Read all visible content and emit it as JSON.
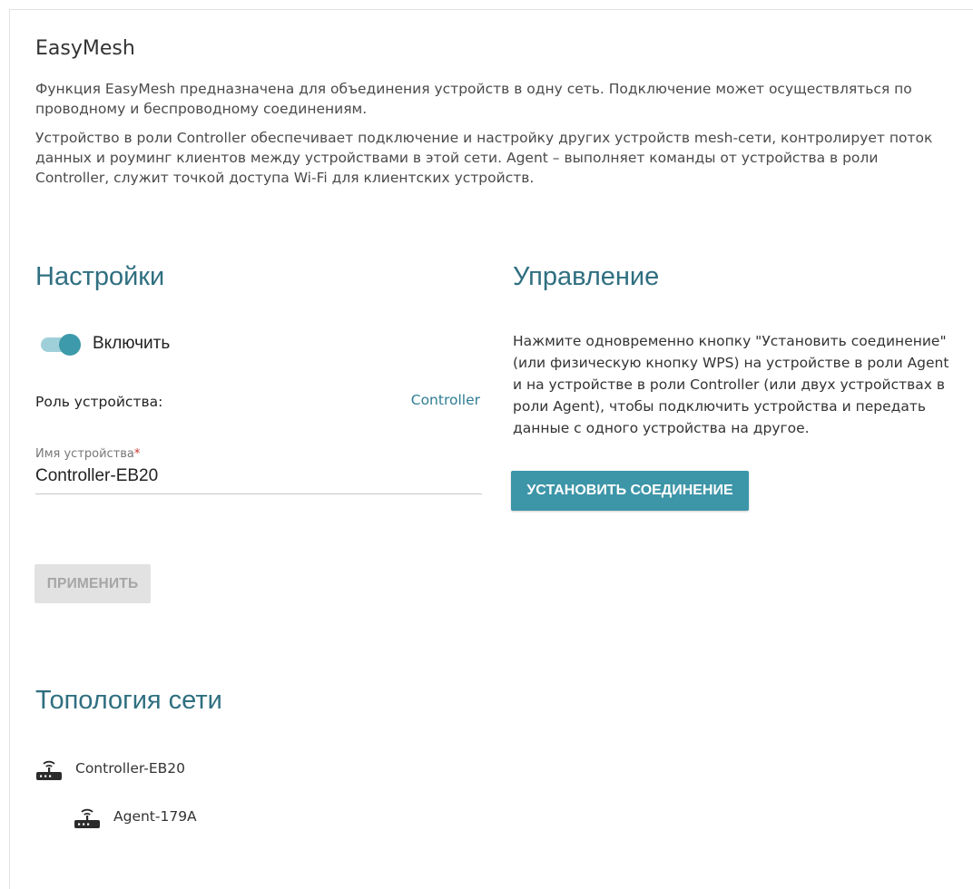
{
  "page": {
    "title": "EasyMesh",
    "description_1": "Функция EasyMesh предназначена для объединения устройств в одну сеть. Подключение может осуществляться по проводному и беспроводному соединениям.",
    "description_2": "Устройство в роли Controller обеспечивает подключение и настройку других устройств mesh-сети, контролирует поток данных и роуминг клиентов между устройствами в этой сети. Agent – выполняет команды от устройства в роли Controller, служит точкой доступа Wi-Fi для клиентских устройств."
  },
  "settings": {
    "title": "Настройки",
    "enable_toggle": {
      "label": "Включить",
      "state": "on"
    },
    "role_label": "Роль устройства:",
    "role_value": "Controller",
    "device_name_label": "Имя устройства",
    "required_mark": "*",
    "device_name_value": "Controller-EB20",
    "apply_label": "ПРИМЕНИТЬ"
  },
  "control": {
    "title": "Управление",
    "text": "Нажмите одновременно кнопку \"Установить соединение\" (или физическую кнопку WPS) на устройстве в роли Agent и на устройстве в роли Controller (или двух устройствах в роли Agent), чтобы подключить устройства и передать данные с одного устройства на другое.",
    "connect_label": "УСТАНОВИТЬ СОЕДИНЕНИЕ"
  },
  "topology": {
    "title": "Топология сети",
    "nodes": [
      {
        "name": "Controller-EB20",
        "icon": "router-icon"
      },
      {
        "name": "Agent-179A",
        "icon": "router-icon"
      }
    ]
  },
  "colors": {
    "accent": "#3d95a8",
    "heading": "#2f6f80",
    "link": "#2f7d93",
    "toggle_track": "#9fd0da",
    "toggle_knob": "#3d9aab",
    "required": "#d0342c",
    "disabled_bg": "#e2e2e2",
    "disabled_text": "#a6a6a6"
  }
}
